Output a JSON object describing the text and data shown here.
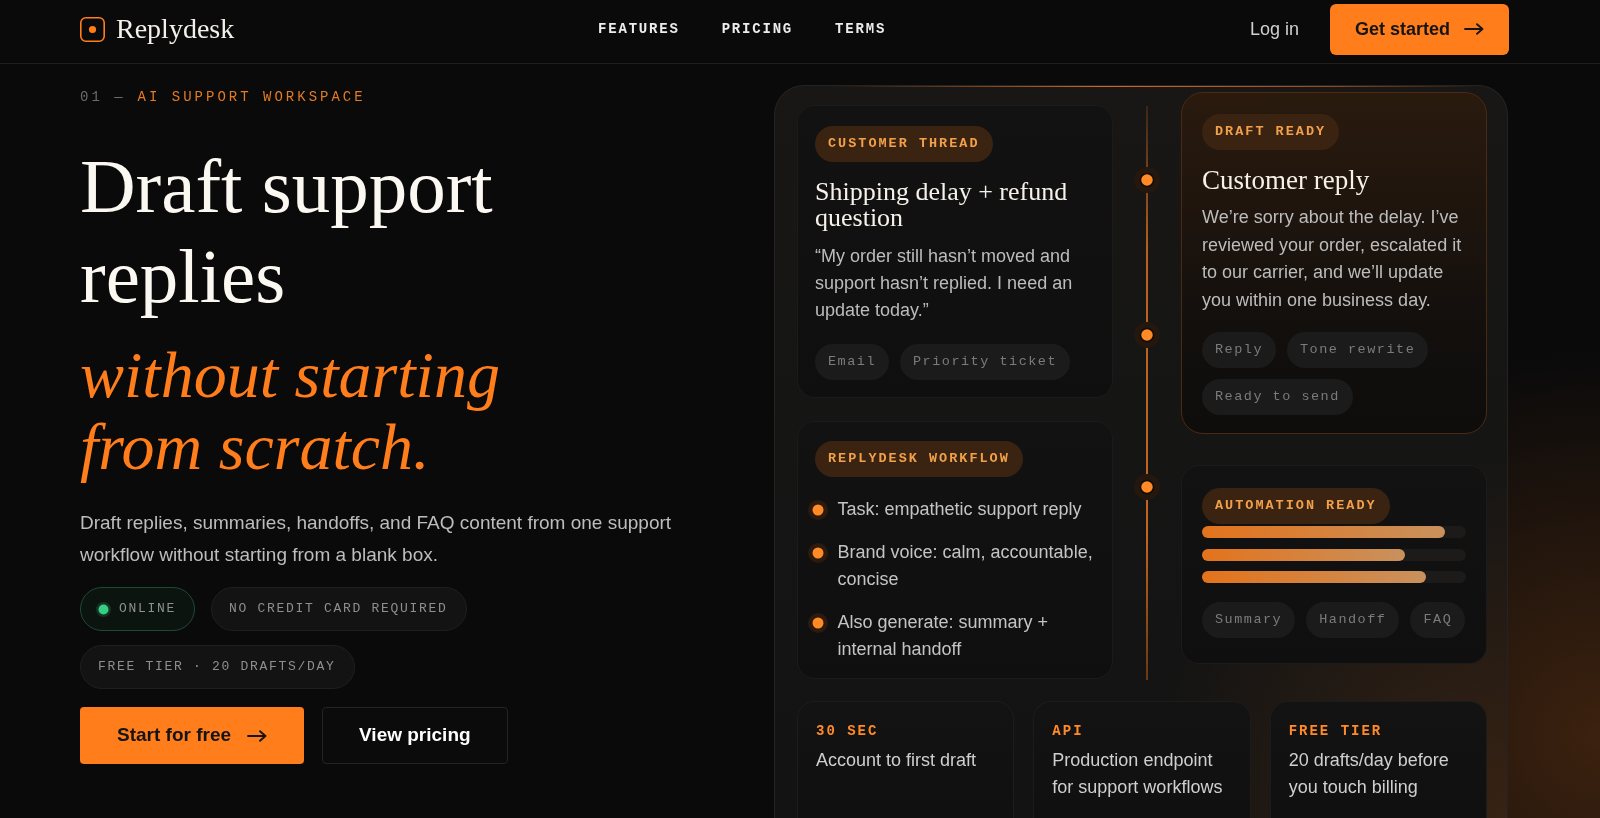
{
  "nav": {
    "brand": "Replydesk",
    "links": [
      {
        "label": "FEATURES"
      },
      {
        "label": "PRICING"
      },
      {
        "label": "TERMS"
      }
    ],
    "login": "Log in",
    "cta": "Get started"
  },
  "hero": {
    "eyebrow_index": "01 —",
    "eyebrow": "AI SUPPORT WORKSPACE",
    "title": "Draft support replies *without starting from scratch.*",
    "subtitle": "Draft replies, summaries, handoffs, and FAQ content from one support workflow without starting from a blank box.",
    "badges": [
      {
        "kind": "status",
        "label": "ONLINE"
      },
      {
        "kind": "plain",
        "label": "NO CREDIT CARD REQUIRED"
      },
      {
        "kind": "plain",
        "label": "FREE TIER · 20 DRAFTS/DAY"
      }
    ],
    "buttons": [
      {
        "kind": "primary",
        "label": "Start for free"
      },
      {
        "kind": "secondary",
        "label": "View pricing"
      }
    ]
  },
  "preview": {
    "thread_card": {
      "tag": "CUSTOMER THREAD",
      "title": "Shipping delay + refund question",
      "text": "“My order still hasn’t moved and support hasn’t replied. I need an update today.”",
      "chips": [
        "Email",
        "Priority ticket"
      ]
    },
    "workflow_card": {
      "tag": "REPLYDESK WORKFLOW",
      "items": [
        "Task: empathetic support reply",
        "Brand voice: calm, accountable, concise",
        "Also generate: summary + internal handoff"
      ]
    },
    "draft_card": {
      "tag": "DRAFT READY",
      "title": "Customer reply",
      "text": "We’re sorry about the delay. I’ve reviewed your order, escalated it to our carrier, and we’ll update you within one business day.",
      "chips": [
        "Reply",
        "Tone rewrite",
        "Ready to send"
      ]
    },
    "automation_card": {
      "tag": "AUTOMATION READY",
      "bars": [
        {
          "level": 0.92
        },
        {
          "level": 0.77
        },
        {
          "level": 0.85
        }
      ],
      "chips": [
        "Summary",
        "Handoff",
        "FAQ"
      ]
    },
    "stats": [
      {
        "label": "30 SEC",
        "text": "Account to first draft"
      },
      {
        "label": "API",
        "text": "Production endpoint for support workflows"
      },
      {
        "label": "FREE TIER",
        "text": "20 drafts/day before you touch billing"
      }
    ]
  }
}
